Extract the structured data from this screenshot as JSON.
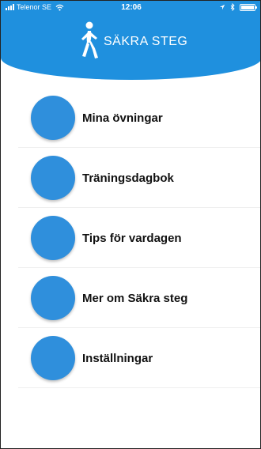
{
  "status_bar": {
    "carrier": "Telenor SE",
    "time": "12:06",
    "signal_icon": "signal-bars-icon",
    "wifi_icon": "wifi-icon",
    "location_icon": "location-arrow-icon",
    "bluetooth_icon": "bluetooth-icon",
    "battery_icon": "battery-icon"
  },
  "header": {
    "title": "SÄKRA STEG",
    "logo_icon": "walking-person-icon",
    "background_color": "#1f90de"
  },
  "menu": {
    "items": [
      {
        "label": "Mina övningar"
      },
      {
        "label": "Träningsdagbok"
      },
      {
        "label": "Tips för vardagen"
      },
      {
        "label": "Mer om Säkra steg"
      },
      {
        "label": "Inställningar"
      }
    ],
    "circle_color": "#2f8fdc"
  }
}
